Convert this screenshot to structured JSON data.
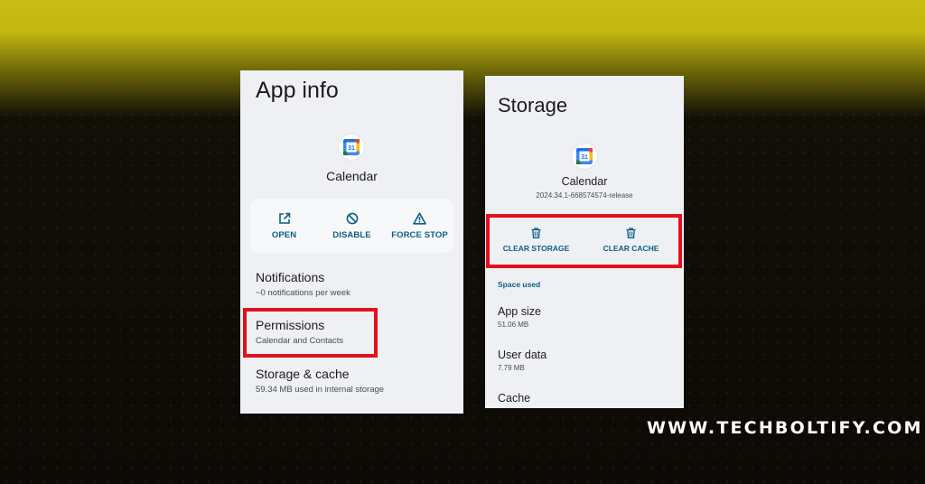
{
  "app_info": {
    "title": "App info",
    "app_name": "Calendar",
    "icon_day": "31",
    "actions": [
      {
        "label": "OPEN",
        "icon": "open-external-icon"
      },
      {
        "label": "DISABLE",
        "icon": "disable-icon"
      },
      {
        "label": "FORCE STOP",
        "icon": "warning-icon"
      }
    ],
    "items": [
      {
        "title": "Notifications",
        "subtitle": "~0 notifications per week"
      },
      {
        "title": "Permissions",
        "subtitle": "Calendar and Contacts"
      },
      {
        "title": "Storage & cache",
        "subtitle": "59.34 MB used in internal storage"
      }
    ]
  },
  "storage": {
    "title": "Storage",
    "app_name": "Calendar",
    "version": "2024.34.1-668574574-release",
    "icon_day": "31",
    "actions": [
      {
        "label": "CLEAR STORAGE",
        "icon": "trash-icon"
      },
      {
        "label": "CLEAR CACHE",
        "icon": "trash-icon"
      }
    ],
    "section_label": "Space used",
    "items": [
      {
        "title": "App size",
        "value": "51.06 MB"
      },
      {
        "title": "User data",
        "value": "7.79 MB"
      },
      {
        "title": "Cache",
        "value": ""
      }
    ]
  },
  "watermark": "WWW.TECHBOLTIFY.COM",
  "colors": {
    "accent": "#0d5f80",
    "highlight": "#e3101b",
    "panel": "#eef0f3"
  }
}
